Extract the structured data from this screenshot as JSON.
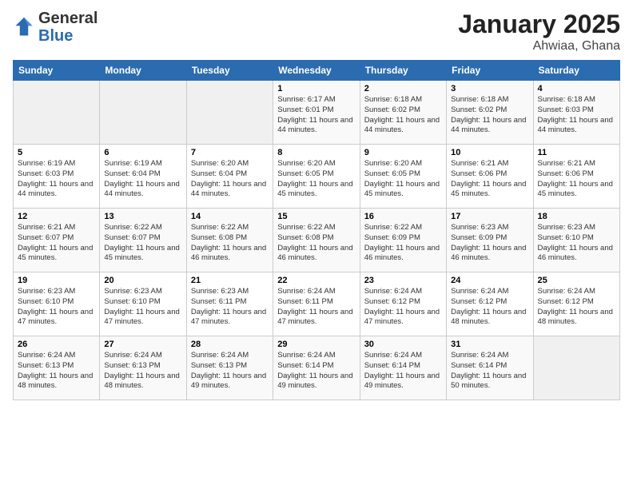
{
  "logo": {
    "general": "General",
    "blue": "Blue"
  },
  "header": {
    "month": "January 2025",
    "location": "Ahwiaa, Ghana"
  },
  "columns": [
    "Sunday",
    "Monday",
    "Tuesday",
    "Wednesday",
    "Thursday",
    "Friday",
    "Saturday"
  ],
  "weeks": [
    [
      {
        "day": "",
        "info": "",
        "empty": true
      },
      {
        "day": "",
        "info": "",
        "empty": true
      },
      {
        "day": "",
        "info": "",
        "empty": true
      },
      {
        "day": "1",
        "info": "Sunrise: 6:17 AM\nSunset: 6:01 PM\nDaylight: 11 hours and 44 minutes."
      },
      {
        "day": "2",
        "info": "Sunrise: 6:18 AM\nSunset: 6:02 PM\nDaylight: 11 hours and 44 minutes."
      },
      {
        "day": "3",
        "info": "Sunrise: 6:18 AM\nSunset: 6:02 PM\nDaylight: 11 hours and 44 minutes."
      },
      {
        "day": "4",
        "info": "Sunrise: 6:18 AM\nSunset: 6:03 PM\nDaylight: 11 hours and 44 minutes."
      }
    ],
    [
      {
        "day": "5",
        "info": "Sunrise: 6:19 AM\nSunset: 6:03 PM\nDaylight: 11 hours and 44 minutes."
      },
      {
        "day": "6",
        "info": "Sunrise: 6:19 AM\nSunset: 6:04 PM\nDaylight: 11 hours and 44 minutes."
      },
      {
        "day": "7",
        "info": "Sunrise: 6:20 AM\nSunset: 6:04 PM\nDaylight: 11 hours and 44 minutes."
      },
      {
        "day": "8",
        "info": "Sunrise: 6:20 AM\nSunset: 6:05 PM\nDaylight: 11 hours and 45 minutes."
      },
      {
        "day": "9",
        "info": "Sunrise: 6:20 AM\nSunset: 6:05 PM\nDaylight: 11 hours and 45 minutes."
      },
      {
        "day": "10",
        "info": "Sunrise: 6:21 AM\nSunset: 6:06 PM\nDaylight: 11 hours and 45 minutes."
      },
      {
        "day": "11",
        "info": "Sunrise: 6:21 AM\nSunset: 6:06 PM\nDaylight: 11 hours and 45 minutes."
      }
    ],
    [
      {
        "day": "12",
        "info": "Sunrise: 6:21 AM\nSunset: 6:07 PM\nDaylight: 11 hours and 45 minutes."
      },
      {
        "day": "13",
        "info": "Sunrise: 6:22 AM\nSunset: 6:07 PM\nDaylight: 11 hours and 45 minutes."
      },
      {
        "day": "14",
        "info": "Sunrise: 6:22 AM\nSunset: 6:08 PM\nDaylight: 11 hours and 46 minutes."
      },
      {
        "day": "15",
        "info": "Sunrise: 6:22 AM\nSunset: 6:08 PM\nDaylight: 11 hours and 46 minutes."
      },
      {
        "day": "16",
        "info": "Sunrise: 6:22 AM\nSunset: 6:09 PM\nDaylight: 11 hours and 46 minutes."
      },
      {
        "day": "17",
        "info": "Sunrise: 6:23 AM\nSunset: 6:09 PM\nDaylight: 11 hours and 46 minutes."
      },
      {
        "day": "18",
        "info": "Sunrise: 6:23 AM\nSunset: 6:10 PM\nDaylight: 11 hours and 46 minutes."
      }
    ],
    [
      {
        "day": "19",
        "info": "Sunrise: 6:23 AM\nSunset: 6:10 PM\nDaylight: 11 hours and 47 minutes."
      },
      {
        "day": "20",
        "info": "Sunrise: 6:23 AM\nSunset: 6:10 PM\nDaylight: 11 hours and 47 minutes."
      },
      {
        "day": "21",
        "info": "Sunrise: 6:23 AM\nSunset: 6:11 PM\nDaylight: 11 hours and 47 minutes."
      },
      {
        "day": "22",
        "info": "Sunrise: 6:24 AM\nSunset: 6:11 PM\nDaylight: 11 hours and 47 minutes."
      },
      {
        "day": "23",
        "info": "Sunrise: 6:24 AM\nSunset: 6:12 PM\nDaylight: 11 hours and 47 minutes."
      },
      {
        "day": "24",
        "info": "Sunrise: 6:24 AM\nSunset: 6:12 PM\nDaylight: 11 hours and 48 minutes."
      },
      {
        "day": "25",
        "info": "Sunrise: 6:24 AM\nSunset: 6:12 PM\nDaylight: 11 hours and 48 minutes."
      }
    ],
    [
      {
        "day": "26",
        "info": "Sunrise: 6:24 AM\nSunset: 6:13 PM\nDaylight: 11 hours and 48 minutes."
      },
      {
        "day": "27",
        "info": "Sunrise: 6:24 AM\nSunset: 6:13 PM\nDaylight: 11 hours and 48 minutes."
      },
      {
        "day": "28",
        "info": "Sunrise: 6:24 AM\nSunset: 6:13 PM\nDaylight: 11 hours and 49 minutes."
      },
      {
        "day": "29",
        "info": "Sunrise: 6:24 AM\nSunset: 6:14 PM\nDaylight: 11 hours and 49 minutes."
      },
      {
        "day": "30",
        "info": "Sunrise: 6:24 AM\nSunset: 6:14 PM\nDaylight: 11 hours and 49 minutes."
      },
      {
        "day": "31",
        "info": "Sunrise: 6:24 AM\nSunset: 6:14 PM\nDaylight: 11 hours and 50 minutes."
      },
      {
        "day": "",
        "info": "",
        "empty": true
      }
    ]
  ]
}
